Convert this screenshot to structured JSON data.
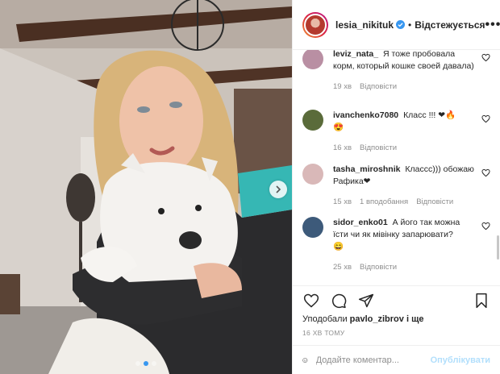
{
  "header": {
    "username": "lesia_nikituk",
    "separator": "•",
    "follow_state": "Відстежується",
    "more_icon": "more-dots-icon"
  },
  "comments": [
    {
      "username": "leviz_nata_",
      "text": "Я тоже пробовала корм, который кошке своей давала)",
      "time": "19 хв",
      "reply": "Відповісти",
      "replies": "",
      "avatar_color": "#b98fa3"
    },
    {
      "username": "ivanchenko7080",
      "text": "Класс !!! ❤🔥",
      "line2": "😍",
      "time": "16 хв",
      "reply": "Відповісти",
      "replies": "",
      "avatar_color": "#5a6b3a"
    },
    {
      "username": "tasha_miroshnik",
      "text": "Классс))) обожаю Рафика❤",
      "time": "15 хв",
      "reply": "Відповісти",
      "replies": "1 вподобання",
      "avatar_color": "#d9b8b8"
    },
    {
      "username": "sidor_enko01",
      "text": "А його так можна їсти чи як мівінку запарювати?",
      "line2": "😄",
      "time": "25 хв",
      "reply": "Відповісти",
      "replies": "",
      "avatar_color": "#3d5a7a"
    }
  ],
  "likes": {
    "prefix": "Уподобали",
    "user": "pavlo_zibrov",
    "suffix": "і ще"
  },
  "timestamp": "16 ХВ ТОМУ",
  "add_comment": {
    "placeholder": "Додайте коментар...",
    "publish": "Опублікувати"
  },
  "carousel": {
    "count": 3,
    "active_index": 1
  },
  "colors": {
    "accent": "#3897f0",
    "publish_disabled": "#b2dffc",
    "muted": "#8e8e8e"
  }
}
